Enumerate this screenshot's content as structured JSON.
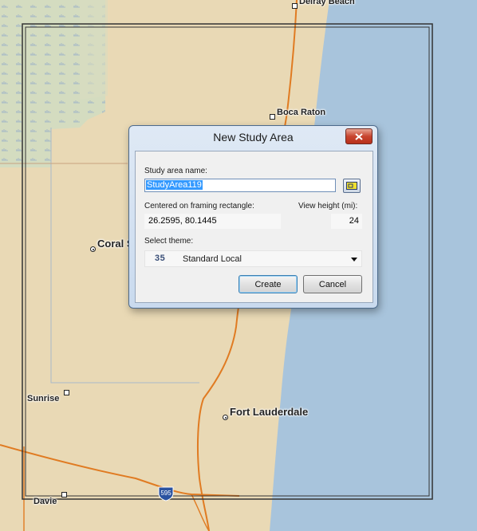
{
  "map": {
    "labels": {
      "delray": "Delray Beach",
      "boca": "Boca Raton",
      "coral": "Coral S",
      "sunrise": "Sunrise",
      "fortlaud": "Fort Lauderdale",
      "davie": "Davie",
      "highway_shield": "595"
    },
    "colors": {
      "land": "#e9d9b5",
      "water": "#a8c4dc",
      "wetland": "#d4dcc0",
      "road": "#e07b22",
      "frame": "#333333"
    }
  },
  "dialog": {
    "title": "New Study Area",
    "close_icon": "close-icon",
    "name_label": "Study area name:",
    "name_value": "StudyArea119",
    "rect_button_icon": "framing-rectangle-icon",
    "center_label": "Centered on framing rectangle:",
    "center_value": "26.2595,  80.1445",
    "height_label": "View height (mi):",
    "height_value": "24",
    "theme_label": "Select theme:",
    "theme_number": "35",
    "theme_name": "Standard Local",
    "create_label": "Create",
    "cancel_label": "Cancel"
  }
}
